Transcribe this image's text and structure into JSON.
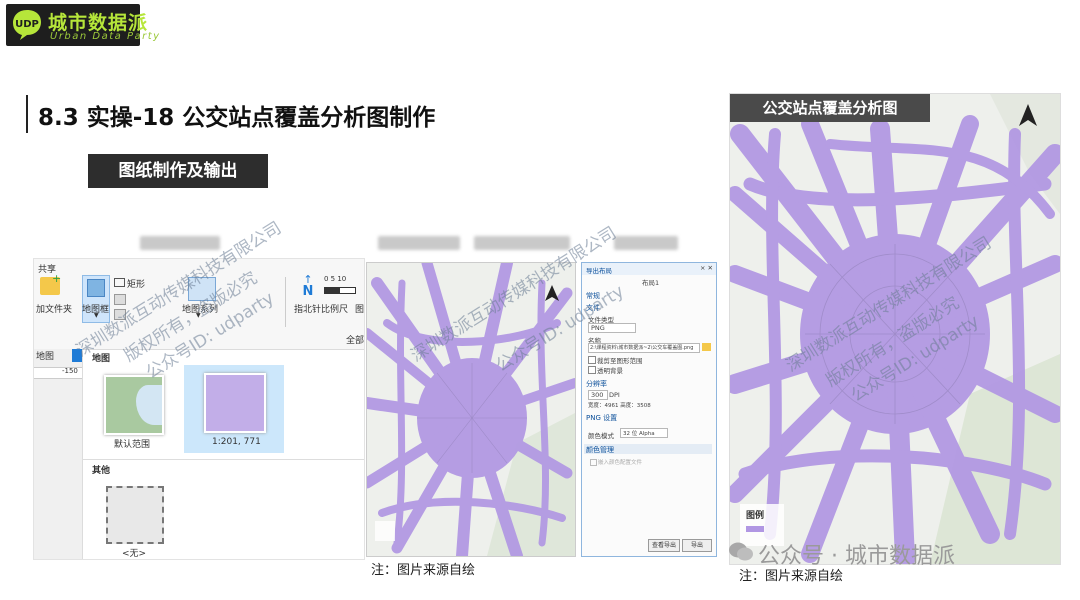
{
  "logo": {
    "title": "城市数据派",
    "subtitle": "Urban Data Party",
    "mark_letters": "UDP"
  },
  "slide": {
    "title": "8.3 实操-18 公交站点覆盖分析图制作",
    "subtitle_tag": "图纸制作及输出"
  },
  "ribbon": {
    "tab_share": "共享",
    "btn_add_folder": "加文件夹",
    "btn_map_frame": "地图框",
    "btn_rectangle": "矩形",
    "btn_map_series": "地图系列",
    "btn_north_arrow": "指北针",
    "btn_scale_bar": "比例尺",
    "btn_truncated": "图",
    "scale_ticks": "0 5 10",
    "label_all": "全部",
    "ruler_value": "-150",
    "tab_map": "地图",
    "section_map": "地图",
    "thumb_default": "默认范围",
    "thumb_scale": "1:201, 771",
    "section_other": "其他",
    "thumb_none": "<无>"
  },
  "dialog": {
    "title": "导出布局",
    "header": "布局1",
    "section_general": "常规",
    "field_file": "文件",
    "label_filetype": "文件类型",
    "filetype_value": "PNG",
    "label_name": "名称",
    "name_value": "2:\\课程资料\\城市数据派~2\\公交车覆盖图.png",
    "check_clip": "裁剪至图形范围",
    "check_transparent": "透明背景",
    "section_resolution": "分辨率",
    "dpi_value": "300",
    "dpi_unit": "DPI",
    "size_text": "宽度：4961 高度：3508",
    "section_png": "PNG 设置",
    "label_color_mode": "颜色模式",
    "color_mode_value": "32 位 Alpha",
    "section_color": "颜色管理",
    "check_embed": "嵌入颜色配置文件",
    "btn_view": "查看导出",
    "btn_export": "导出"
  },
  "map_right": {
    "title_tag": "公交站点覆盖分析图",
    "legend": "图例"
  },
  "notes": {
    "left": "注：图片来源自绘",
    "right": "注：图片来源自绘"
  },
  "watermarks": {
    "line1": "深圳数派互动传媒科技有限公司",
    "line2": "版权所有，盗版必究",
    "line3": "公众号ID: udparty",
    "bottom": "公众号 · 城市数据派"
  },
  "colors": {
    "coverage": "#b197e3",
    "coverage_edge": "#9177d0",
    "logo_green": "#b6e63a",
    "accent_blue": "#1f7bd6"
  }
}
